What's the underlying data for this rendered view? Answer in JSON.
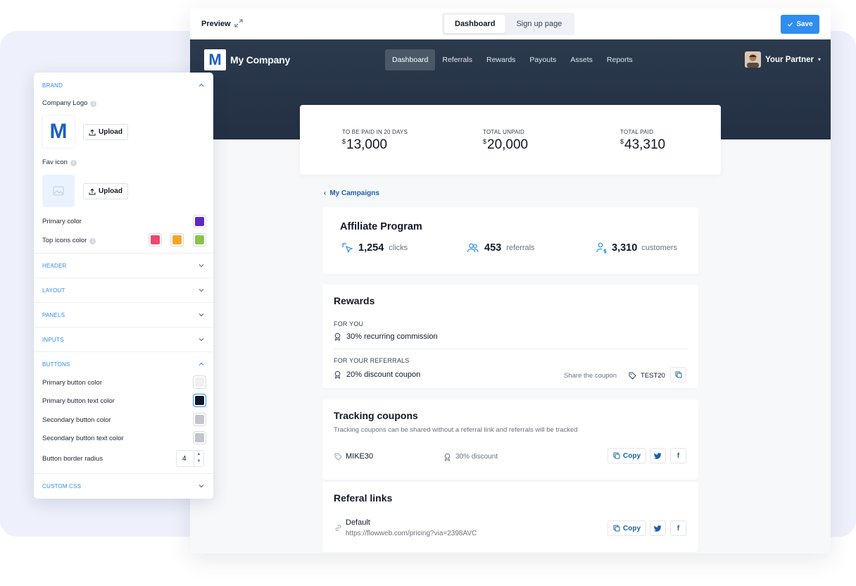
{
  "preview": {
    "label": "Preview",
    "tabs": [
      {
        "label": "Dashboard",
        "active": true
      },
      {
        "label": "Sign up page",
        "active": false
      }
    ],
    "save_label": "Save"
  },
  "portal": {
    "logo_letter": "M",
    "company_name": "My Company",
    "nav": [
      "Dashboard",
      "Referrals",
      "Rewards",
      "Payouts",
      "Assets",
      "Reports"
    ],
    "partner_name": "Your Partner",
    "stats": [
      {
        "label": "TO BE PAID IN 20 DAYS",
        "currency": "$",
        "value": "13,000"
      },
      {
        "label": "TOTAL UNPAID",
        "currency": "$",
        "value": "20,000"
      },
      {
        "label": "TOTAL PAID",
        "currency": "$",
        "value": "43,310"
      }
    ],
    "back_link": "My Campaigns",
    "program": {
      "title": "Affiliate Program",
      "clicks": "1,254",
      "clicks_label": "clicks",
      "referrals": "453",
      "referrals_label": "referrals",
      "customers": "3,310",
      "customers_label": "customers"
    },
    "rewards": {
      "title": "Rewards",
      "for_you_label": "FOR YOU",
      "for_you_value": "30% recurring commission",
      "for_referrals_label": "FOR YOUR REFERRALS",
      "for_referrals_value": "20% discount coupon",
      "share_label": "Share the coupon",
      "coupon_code": "TEST20"
    },
    "tracking": {
      "title": "Tracking coupons",
      "description": "Tracking coupons can be shared without a referral link and referrals will be tracked",
      "code": "MIKE30",
      "discount": "30% discount",
      "copy_label": "Copy"
    },
    "links": {
      "title": "Referal links",
      "name": "Default",
      "url": "https://flowweb.com/pricing?via=2398AVC",
      "copy_label": "Copy"
    }
  },
  "settings": {
    "brand_header": "BRAND",
    "company_logo_label": "Company Logo",
    "logo_letter": "M",
    "upload_label": "Upload",
    "fav_icon_label": "Fav icon",
    "primary_color_label": "Primary color",
    "top_icons_color_label": "Top icons color",
    "primary_color": "#5b2bc2",
    "top_icon_colors": [
      "#ef476f",
      "#f7a529",
      "#8bc34a"
    ],
    "sections": [
      "HEADER",
      "LAYOUT",
      "PANELS",
      "INPUTS"
    ],
    "buttons_header": "BUTTONS",
    "primary_button_color_label": "Primary button color",
    "primary_button_text_color_label": "Primary button text color",
    "secondary_button_color_label": "Secondary button color",
    "secondary_button_text_color_label": "Secondary button text color",
    "button_colors": [
      "#eef0f2",
      "#0e1a2b",
      "#c2c6cb",
      "#c2c6cb"
    ],
    "border_radius_label": "Button border radius",
    "border_radius_value": "4",
    "custom_css_header": "CUSTOM CSS"
  }
}
